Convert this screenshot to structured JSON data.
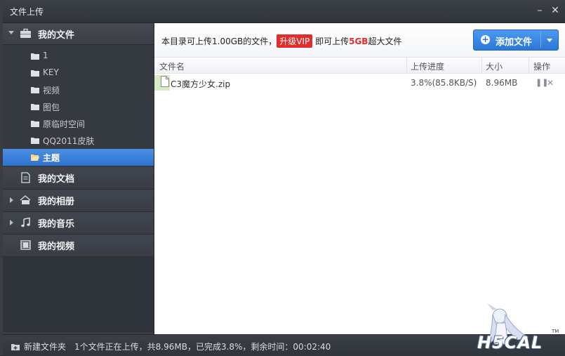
{
  "window": {
    "title": "文件上传"
  },
  "sidebar": {
    "my_files": "我的文件",
    "folders": [
      "1",
      "KEY",
      "视频",
      "图包",
      "原临时空间",
      "QQ2011皮肤"
    ],
    "selected_folder": "主题",
    "sections": [
      {
        "label": "我的文档",
        "icon": "document-icon"
      },
      {
        "label": "我的相册",
        "icon": "album-icon"
      },
      {
        "label": "我的音乐",
        "icon": "music-icon"
      },
      {
        "label": "我的视频",
        "icon": "video-icon"
      }
    ]
  },
  "notice": {
    "prefix": "本目录可上传1.00GB的文件，",
    "vip": "升级VIP",
    "middle": " 即可上传",
    "highlight": "5GB",
    "suffix": "超大文件"
  },
  "toolbar": {
    "add_file": "添加文件"
  },
  "table": {
    "headers": [
      "文件名",
      "上传进度",
      "大小",
      "操作"
    ],
    "rows": [
      {
        "name": "C3魔方少女.zip",
        "progress": "3.8%(85.8KB/S)",
        "size": "8.96MB"
      }
    ]
  },
  "status": {
    "new_folder": "新建文件夹",
    "text": "1个文件正在上传，共8.96MB，已完成3.8%，剩余时间：00:02:40"
  },
  "watermark": {
    "text": "H5CAL",
    "tm": "TM"
  },
  "colors": {
    "accent": "#2f74cf",
    "vip": "#e22b2b",
    "progress_mark": "#d6ecc6"
  }
}
